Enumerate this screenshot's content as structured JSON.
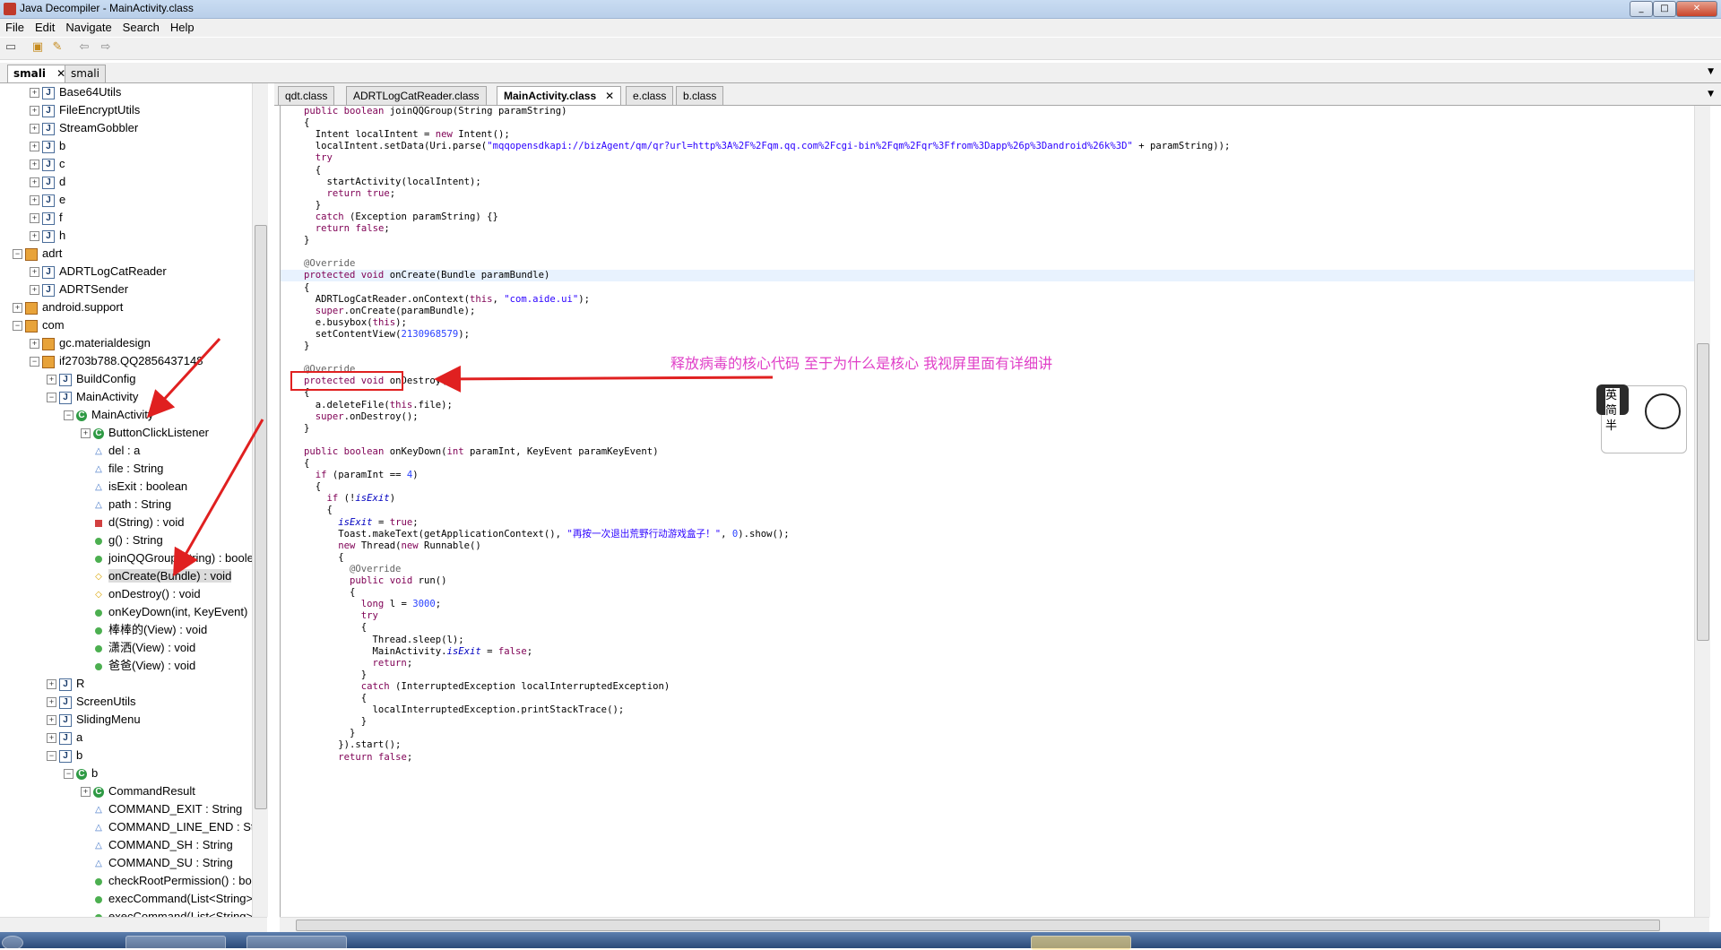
{
  "window": {
    "title": "Java Decompiler - MainActivity.class"
  },
  "menu": [
    "File",
    "Edit",
    "Navigate",
    "Search",
    "Help"
  ],
  "toolbar": {
    "icons": [
      "open-file-icon",
      "open-type-icon",
      "find-icon",
      "back-icon",
      "forward-icon"
    ]
  },
  "left_tabs": [
    {
      "label": "smali",
      "active": true
    },
    {
      "label": "smali",
      "active": false
    }
  ],
  "tree": [
    {
      "label": "Base64Utils",
      "icon": "class"
    },
    {
      "label": "FileEncryptUtils",
      "icon": "class"
    },
    {
      "label": "StreamGobbler",
      "icon": "class"
    },
    {
      "label": "b",
      "icon": "class"
    },
    {
      "label": "c",
      "icon": "class"
    },
    {
      "label": "d",
      "icon": "class"
    },
    {
      "label": "e",
      "icon": "class"
    },
    {
      "label": "f",
      "icon": "class"
    },
    {
      "label": "h",
      "icon": "class"
    },
    {
      "label": "adrt",
      "icon": "package"
    },
    {
      "label": "ADRTLogCatReader",
      "icon": "class"
    },
    {
      "label": "ADRTSender",
      "icon": "class"
    },
    {
      "label": "android.support",
      "icon": "package"
    },
    {
      "label": "com",
      "icon": "package"
    },
    {
      "label": "gc.materialdesign",
      "icon": "package"
    },
    {
      "label": "if2703b788.QQ2856437148",
      "icon": "package"
    },
    {
      "label": "BuildConfig",
      "icon": "class"
    },
    {
      "label": "MainActivity",
      "icon": "class"
    },
    {
      "label": "MainActivity",
      "icon": "classnode"
    },
    {
      "label": "ButtonClickListener",
      "icon": "classnode"
    },
    {
      "label": "del : a",
      "icon": "field"
    },
    {
      "label": "file : String",
      "icon": "field"
    },
    {
      "label": "isExit : boolean",
      "icon": "sfield"
    },
    {
      "label": "path : String",
      "icon": "field"
    },
    {
      "label": "d(String) : void",
      "icon": "private"
    },
    {
      "label": "g() : String",
      "icon": "public"
    },
    {
      "label": "joinQQGroup(String) : boole",
      "icon": "public"
    },
    {
      "label": "onCreate(Bundle) : void",
      "icon": "protected"
    },
    {
      "label": "onDestroy() : void",
      "icon": "protected"
    },
    {
      "label": "onKeyDown(int, KeyEvent) :",
      "icon": "public"
    },
    {
      "label": "棒棒的(View) : void",
      "icon": "public"
    },
    {
      "label": "潇洒(View) : void",
      "icon": "public"
    },
    {
      "label": "爸爸(View) : void",
      "icon": "public"
    },
    {
      "label": "R",
      "icon": "class"
    },
    {
      "label": "ScreenUtils",
      "icon": "class"
    },
    {
      "label": "SlidingMenu",
      "icon": "class"
    },
    {
      "label": "a",
      "icon": "class"
    },
    {
      "label": "b",
      "icon": "class"
    },
    {
      "label": "b",
      "icon": "classnode"
    },
    {
      "label": "CommandResult",
      "icon": "classnode"
    },
    {
      "label": "COMMAND_EXIT : String",
      "icon": "sfield"
    },
    {
      "label": "COMMAND_LINE_END : Str",
      "icon": "sfield"
    },
    {
      "label": "COMMAND_SH : String",
      "icon": "sfield"
    },
    {
      "label": "COMMAND_SU : String",
      "icon": "sfield"
    },
    {
      "label": "checkRootPermission() : bo",
      "icon": "spublic"
    },
    {
      "label": "execCommand(List<String>",
      "icon": "spublic"
    },
    {
      "label": "execCommand(List<String>",
      "icon": "spublic"
    }
  ],
  "editor_tabs": [
    {
      "label": "qdt.class",
      "active": false
    },
    {
      "label": "ADRTLogCatReader.class",
      "active": false
    },
    {
      "label": "MainActivity.class",
      "active": true
    },
    {
      "label": "e.class",
      "active": false
    },
    {
      "label": "b.class",
      "active": false
    }
  ],
  "code": [
    "public boolean joinQQGroup(String paramString)",
    "{",
    "  Intent localIntent = new Intent();",
    "  localIntent.setData(Uri.parse(\"mqqopensdkapi://bizAgent/qm/qr?url=http%3A%2F%2Fqm.qq.com%2Fcgi-bin%2Fqm%2Fqr%3Ffrom%3Dapp%26p%3Dandroid%26k%3D\" + paramString));",
    "  try",
    "  {",
    "    startActivity(localIntent);",
    "    return true;",
    "  }",
    "  catch (Exception paramString) {}",
    "  return false;",
    "}",
    "",
    "@Override",
    "protected void onCreate(Bundle paramBundle)",
    "{",
    "  ADRTLogCatReader.onContext(this, \"com.aide.ui\");",
    "  super.onCreate(paramBundle);",
    "  e.busybox(this);",
    "  setContentView(2130968579);",
    "}",
    "",
    "@Override",
    "protected void onDestroy()",
    "{",
    "  a.deleteFile(this.file);",
    "  super.onDestroy();",
    "}",
    "",
    "public boolean onKeyDown(int paramInt, KeyEvent paramKeyEvent)",
    "{",
    "  if (paramInt == 4)",
    "  {",
    "    if (!isExit)",
    "    {",
    "      isExit = true;",
    "      Toast.makeText(getApplicationContext(), \"再按一次退出荒野行动游戏盒子！\", 0).show();",
    "      new Thread(new Runnable()",
    "      {",
    "        @Override",
    "        public void run()",
    "        {",
    "          long l = 3000;",
    "          try",
    "          {",
    "            Thread.sleep(l);",
    "            MainActivity.isExit = false;",
    "            return;",
    "          }",
    "          catch (InterruptedException localInterruptedException)",
    "          {",
    "            localInterruptedException.printStackTrace();",
    "          }",
    "        }",
    "      }).start();",
    "      return false;"
  ],
  "annotation": {
    "text": "释放病毒的核心代码 至于为什么是核心 我视屏里面有详细讲"
  },
  "sticker": {
    "text": "英简半"
  },
  "colors": {
    "annotation_text": "#e040c8",
    "annotation_box": "#e02020",
    "keyword": "#7f0055",
    "string": "#2a00ff"
  }
}
